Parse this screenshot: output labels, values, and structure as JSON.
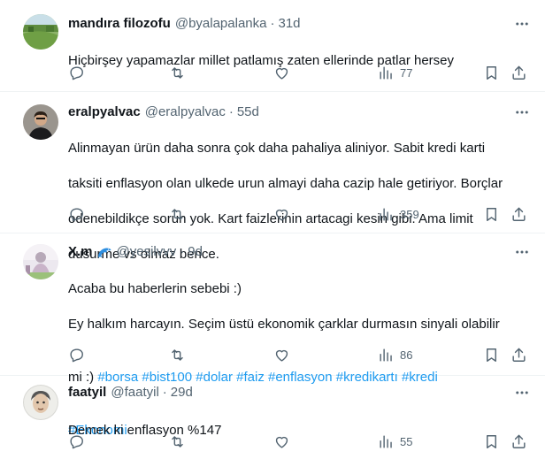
{
  "tweets": [
    {
      "name": "mandıra filozofu",
      "handle": "@byalapalanka",
      "time": "31d",
      "lines": [
        "Hiçbirşey yapamazlar  millet patlamış zaten ellerinde patlar hersey"
      ],
      "views": "77"
    },
    {
      "name": "eralpyalvac",
      "handle": "@eralpyalvac",
      "time": "55d",
      "lines": [
        "Alinmayan ürün daha sonra çok daha pahaliya aliniyor. Sabit kredi karti",
        "taksiti enflasyon olan ulkede urun almayi daha cazip hale getiriyor. Borçlar",
        "odenebildikçe sorun yok. Kart faizlerinin artacagi kesin gibi. Ama limit",
        "dusurme vs olmaz bence."
      ],
      "views": "359"
    },
    {
      "name": "X.m",
      "handle": "@yesilvvv",
      "time": "9d",
      "line1": "Acaba bu haberlerin sebebi :)",
      "line2": "Ey halkım harcayın. Seçim üstü ekonomik çarklar durmasın sinyali olabilir",
      "line3_text": "mi :) ",
      "hashtags": [
        "#borsa",
        "#bist100",
        "#dolar",
        "#faiz",
        "#enflasyon",
        "#kredikartı",
        "#kredi",
        "#Ekonomi"
      ],
      "views": "86"
    },
    {
      "name": "faatyil",
      "handle": "@faatyil",
      "time": "29d",
      "lines": [
        "Demek ki enflasyon %147"
      ],
      "views": "55"
    }
  ],
  "separator": "·",
  "icons": [
    "more-icon",
    "reply-icon",
    "retweet-icon",
    "like-icon",
    "views-icon",
    "bookmark-icon",
    "share-icon",
    "dolphin-emoji-icon"
  ],
  "colors": {
    "text": "#0f1419",
    "secondary": "#536471",
    "link": "#1d9bf0",
    "border": "#eff3f4"
  }
}
